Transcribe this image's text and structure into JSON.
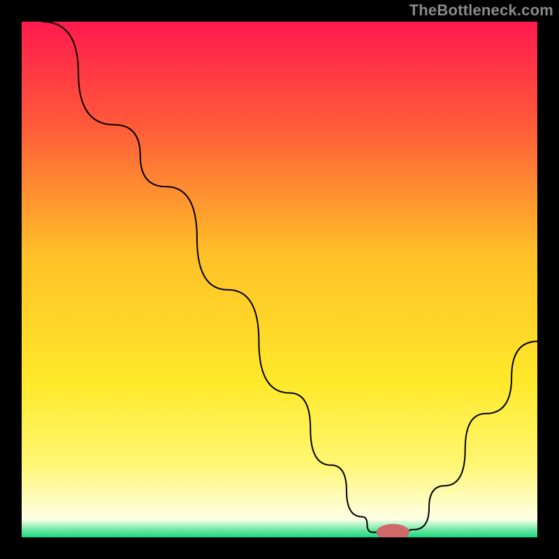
{
  "watermark": "TheBottleneck.com",
  "chart_data": {
    "type": "line",
    "title": "",
    "xlabel": "",
    "ylabel": "",
    "xlim": [
      0,
      100
    ],
    "ylim": [
      0,
      100
    ],
    "grid": false,
    "legend": false,
    "background_gradient_stops": [
      {
        "offset": 0.0,
        "color": "#ff1a4e"
      },
      {
        "offset": 0.2,
        "color": "#ff5a3a"
      },
      {
        "offset": 0.45,
        "color": "#ffc028"
      },
      {
        "offset": 0.7,
        "color": "#ffe92a"
      },
      {
        "offset": 0.86,
        "color": "#fff775"
      },
      {
        "offset": 0.965,
        "color": "#ffffe6"
      },
      {
        "offset": 0.985,
        "color": "#6fe8a6"
      },
      {
        "offset": 1.0,
        "color": "#17d980"
      }
    ],
    "curve_points": [
      {
        "x": 4,
        "y": 100
      },
      {
        "x": 18,
        "y": 80
      },
      {
        "x": 28,
        "y": 68
      },
      {
        "x": 40,
        "y": 48
      },
      {
        "x": 52,
        "y": 28
      },
      {
        "x": 60,
        "y": 14
      },
      {
        "x": 66,
        "y": 4
      },
      {
        "x": 68,
        "y": 1
      },
      {
        "x": 71,
        "y": 0.7
      },
      {
        "x": 74,
        "y": 0.7
      },
      {
        "x": 76,
        "y": 1.5
      },
      {
        "x": 82,
        "y": 10
      },
      {
        "x": 90,
        "y": 24
      },
      {
        "x": 100,
        "y": 38
      }
    ],
    "marker": {
      "x": 72,
      "y": 1.0,
      "rx": 3.2,
      "ry": 1.6,
      "color": "#d06a6a"
    }
  }
}
